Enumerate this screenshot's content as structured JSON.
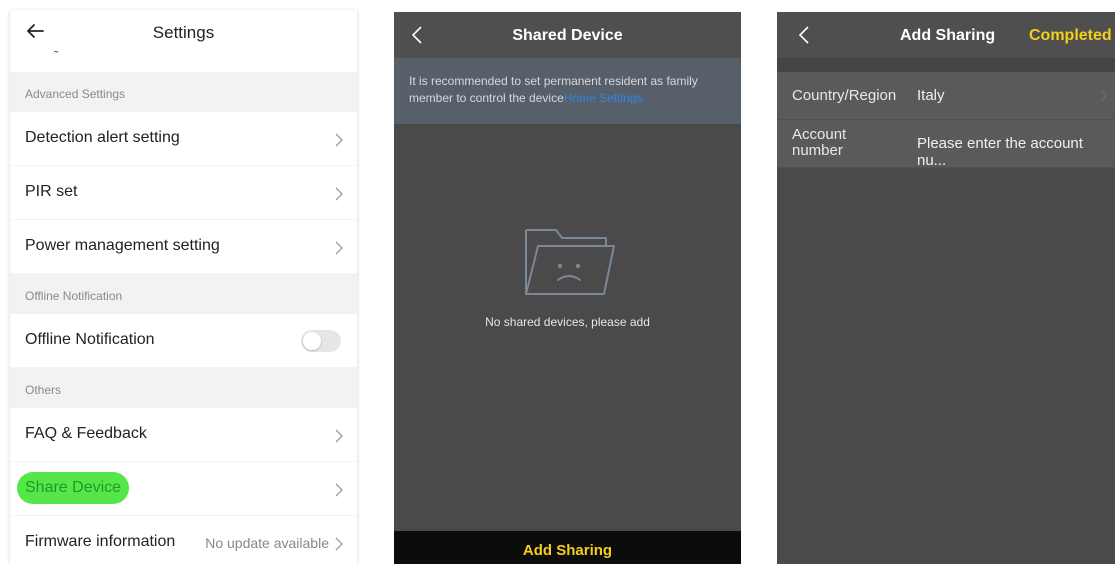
{
  "settings_panel": {
    "title": "Settings",
    "cut_text": "˜",
    "sections": [
      {
        "header": "Advanced Settings"
      },
      {
        "header": "Offline Notification"
      },
      {
        "header": "Others"
      }
    ],
    "items": {
      "detection_alert": "Detection alert setting",
      "pir_set": "PIR set",
      "power_management": "Power management setting",
      "offline_notification": "Offline Notification",
      "faq_feedback": "FAQ & Feedback",
      "share_device": "Share Device",
      "firmware_info": "Firmware information",
      "firmware_value": "No update available"
    },
    "offline_toggle_on": false,
    "highlight_color": "#55e64a"
  },
  "shared_panel": {
    "title": "Shared Device",
    "notice_text": "It is recommended to set permanent resident as family member to control the device",
    "notice_link": "Home Settings",
    "empty_text": "No shared devices, please add",
    "add_button": "Add Sharing",
    "accent_color": "#f4cf1a",
    "empty_icon": "sad-folder-icon"
  },
  "add_panel": {
    "title": "Add Sharing",
    "done_label": "Completed",
    "country_label": "Country/Region",
    "country_value": "Italy",
    "account_label_line1": "Account",
    "account_label_line2": "number",
    "account_placeholder": "Please enter the account nu..."
  }
}
